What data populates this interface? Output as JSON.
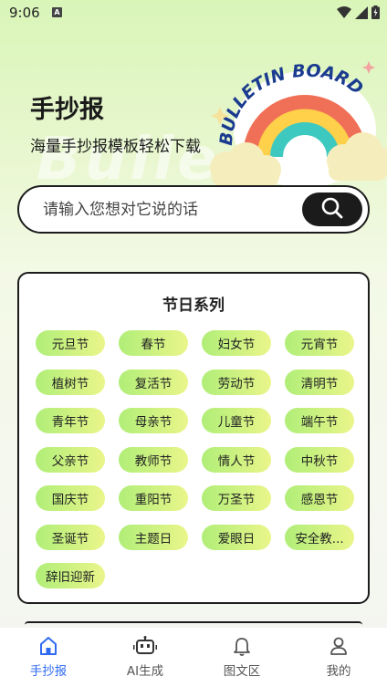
{
  "status_bar": {
    "time": "9:06"
  },
  "hero": {
    "title": "手抄报",
    "subtitle": "海量手抄报模板轻松下载"
  },
  "illustration": {
    "badge_text": "BULLETIN BOARD"
  },
  "search": {
    "placeholder": "请输入您想对它说的话"
  },
  "festival_section": {
    "title": "节日系列",
    "tags": [
      "元旦节",
      "春节",
      "妇女节",
      "元宵节",
      "植树节",
      "复活节",
      "劳动节",
      "清明节",
      "青年节",
      "母亲节",
      "儿童节",
      "端午节",
      "父亲节",
      "教师节",
      "情人节",
      "中秋节",
      "国庆节",
      "重阳节",
      "万圣节",
      "感恩节",
      "圣诞节",
      "主题日",
      "爱眼日",
      "安全教...",
      "辞旧迎新"
    ]
  },
  "bottom_nav": {
    "items": [
      {
        "label": "手抄报",
        "icon": "home-icon",
        "active": true
      },
      {
        "label": "AI生成",
        "icon": "robot-icon",
        "active": false
      },
      {
        "label": "图文区",
        "icon": "bell-icon",
        "active": false
      },
      {
        "label": "我的",
        "icon": "user-icon",
        "active": false
      }
    ]
  },
  "colors": {
    "accent": "#2f6bf0",
    "tag_start": "#b0ee78",
    "tag_end": "#eaf58a",
    "dark": "#1b1b1b"
  }
}
